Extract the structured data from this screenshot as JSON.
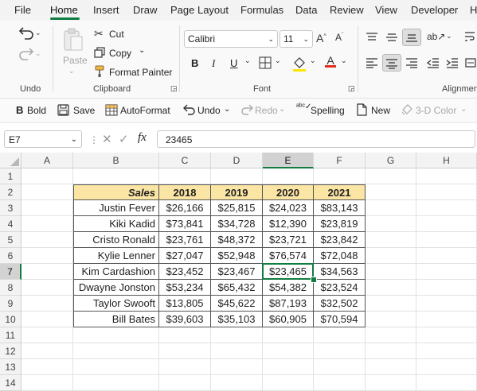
{
  "menu_tabs": [
    "File",
    "Home",
    "Insert",
    "Draw",
    "Page Layout",
    "Formulas",
    "Data",
    "Review",
    "View",
    "Developer",
    "H"
  ],
  "ribbon": {
    "undo_group_label": "Undo",
    "clipboard": {
      "paste": "Paste",
      "cut": "Cut",
      "copy": "Copy",
      "format_painter": "Format Painter",
      "group_label": "Clipboard"
    },
    "font": {
      "font_name": "Calibri",
      "font_size": "11",
      "bold": "B",
      "italic": "I",
      "underline": "U",
      "group_label": "Font"
    },
    "alignment": {
      "group_label": "Alignmen"
    }
  },
  "quick_access": {
    "bold": "Bold",
    "save": "Save",
    "autoformat": "AutoFormat",
    "undo": "Undo",
    "redo": "Redo",
    "spelling": "Spelling",
    "new": "New",
    "three_d_color": "3-D Color"
  },
  "formula_bar": {
    "name_box": "E7",
    "formula": "23465",
    "fx": "fx"
  },
  "sheet": {
    "columns": [
      "A",
      "B",
      "C",
      "D",
      "E",
      "F",
      "G",
      "H"
    ],
    "rows": [
      "1",
      "2",
      "3",
      "4",
      "5",
      "6",
      "7",
      "8",
      "9",
      "10",
      "11",
      "12",
      "13",
      "14"
    ],
    "selected_column": "E",
    "selected_row": "7",
    "table": {
      "header": [
        "Sales",
        "2018",
        "2019",
        "2020",
        "2021"
      ],
      "rows": [
        [
          "Justin Fever",
          "$26,166",
          "$25,815",
          "$24,023",
          "$83,143"
        ],
        [
          "Kiki Kadid",
          "$73,841",
          "$34,728",
          "$12,390",
          "$23,819"
        ],
        [
          "Cristo Ronald",
          "$23,761",
          "$48,372",
          "$23,721",
          "$23,842"
        ],
        [
          "Kylie Lenner",
          "$27,047",
          "$52,948",
          "$76,574",
          "$72,048"
        ],
        [
          "Kim Cardashion",
          "$23,452",
          "$23,467",
          "$23,465",
          "$34,563"
        ],
        [
          "Dwayne Jonston",
          "$53,234",
          "$65,432",
          "$54,382",
          "$23,524"
        ],
        [
          "Taylor Swooft",
          "$13,805",
          "$45,622",
          "$87,193",
          "$32,502"
        ],
        [
          "Bill Bates",
          "$39,603",
          "$35,103",
          "$60,905",
          "$70,594"
        ]
      ]
    }
  },
  "colors": {
    "accent": "#107c41",
    "header_fill": "#fbe5a4",
    "font_color_bar": "#e0301e"
  }
}
